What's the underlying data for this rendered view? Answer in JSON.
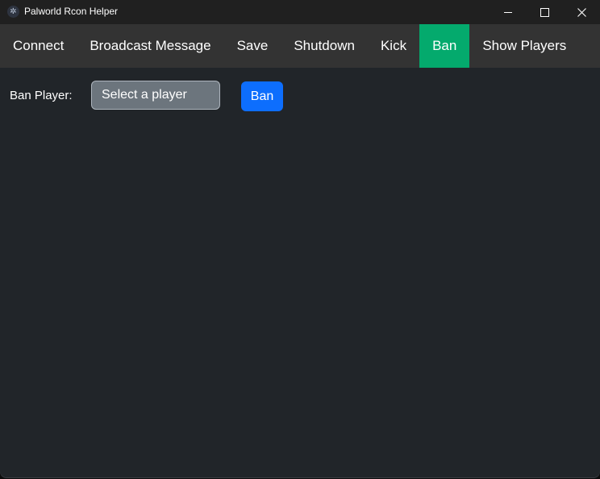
{
  "window": {
    "title": "Palworld Rcon Helper",
    "app_icon": "app-logo-icon",
    "controls": {
      "minimize": "minimize-icon",
      "maximize": "maximize-icon",
      "close": "close-icon"
    }
  },
  "navbar": {
    "items": [
      {
        "label": "Connect",
        "active": false
      },
      {
        "label": "Broadcast Message",
        "active": false
      },
      {
        "label": "Save",
        "active": false
      },
      {
        "label": "Shutdown",
        "active": false
      },
      {
        "label": "Kick",
        "active": false
      },
      {
        "label": "Ban",
        "active": true
      },
      {
        "label": "Show Players",
        "active": false
      }
    ],
    "active_color": "#04aa6d"
  },
  "ban_form": {
    "label": "Ban Player:",
    "select_value": "Select a player",
    "button_label": "Ban",
    "button_color": "#0d6efd"
  }
}
